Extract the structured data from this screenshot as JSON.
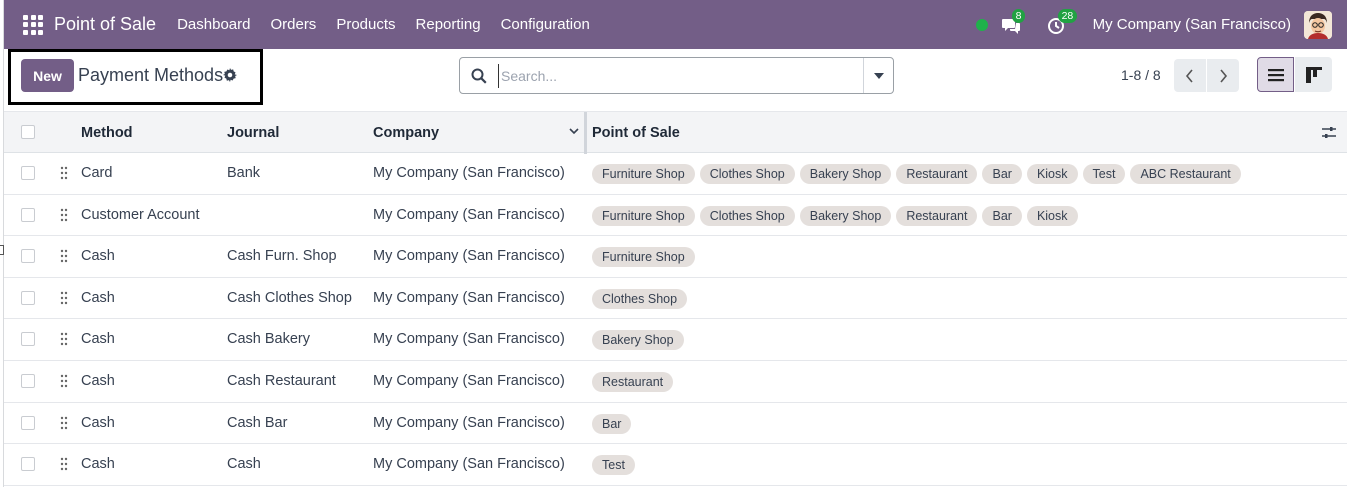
{
  "app": {
    "title": "Point of Sale"
  },
  "nav": {
    "items": [
      "Dashboard",
      "Orders",
      "Products",
      "Reporting",
      "Configuration"
    ],
    "messages_badge": "8",
    "activities_badge": "28",
    "company": "My Company (San Francisco)",
    "icons": [
      "apps-grid-icon",
      "status-online-dot",
      "chat-icon",
      "activity-clock-icon",
      "user-avatar"
    ]
  },
  "control": {
    "new_label": "New",
    "breadcrumb": "Payment Methods",
    "search_placeholder": "Search...",
    "pager": "1-8 / 8"
  },
  "table": {
    "columns": [
      "Method",
      "Journal",
      "Company",
      "Point of Sale"
    ],
    "rows": [
      {
        "method": "Card",
        "journal": "Bank",
        "company": "My Company (San Francisco)",
        "pos": [
          "Furniture Shop",
          "Clothes Shop",
          "Bakery Shop",
          "Restaurant",
          "Bar",
          "Kiosk",
          "Test",
          "ABC Restaurant"
        ]
      },
      {
        "method": "Customer Account",
        "journal": "",
        "company": "My Company (San Francisco)",
        "pos": [
          "Furniture Shop",
          "Clothes Shop",
          "Bakery Shop",
          "Restaurant",
          "Bar",
          "Kiosk"
        ]
      },
      {
        "method": "Cash",
        "journal": "Cash Furn. Shop",
        "company": "My Company (San Francisco)",
        "pos": [
          "Furniture Shop"
        ]
      },
      {
        "method": "Cash",
        "journal": "Cash Clothes Shop",
        "company": "My Company (San Francisco)",
        "pos": [
          "Clothes Shop"
        ]
      },
      {
        "method": "Cash",
        "journal": "Cash Bakery",
        "company": "My Company (San Francisco)",
        "pos": [
          "Bakery Shop"
        ]
      },
      {
        "method": "Cash",
        "journal": "Cash Restaurant",
        "company": "My Company (San Francisco)",
        "pos": [
          "Restaurant"
        ]
      },
      {
        "method": "Cash",
        "journal": "Cash Bar",
        "company": "My Company (San Francisco)",
        "pos": [
          "Bar"
        ]
      },
      {
        "method": "Cash",
        "journal": "Cash",
        "company": "My Company (San Francisco)",
        "pos": [
          "Test"
        ]
      }
    ]
  },
  "colors": {
    "brand": "#735e87",
    "badge": "#21a243",
    "tag_bg": "#e4dfdc"
  }
}
